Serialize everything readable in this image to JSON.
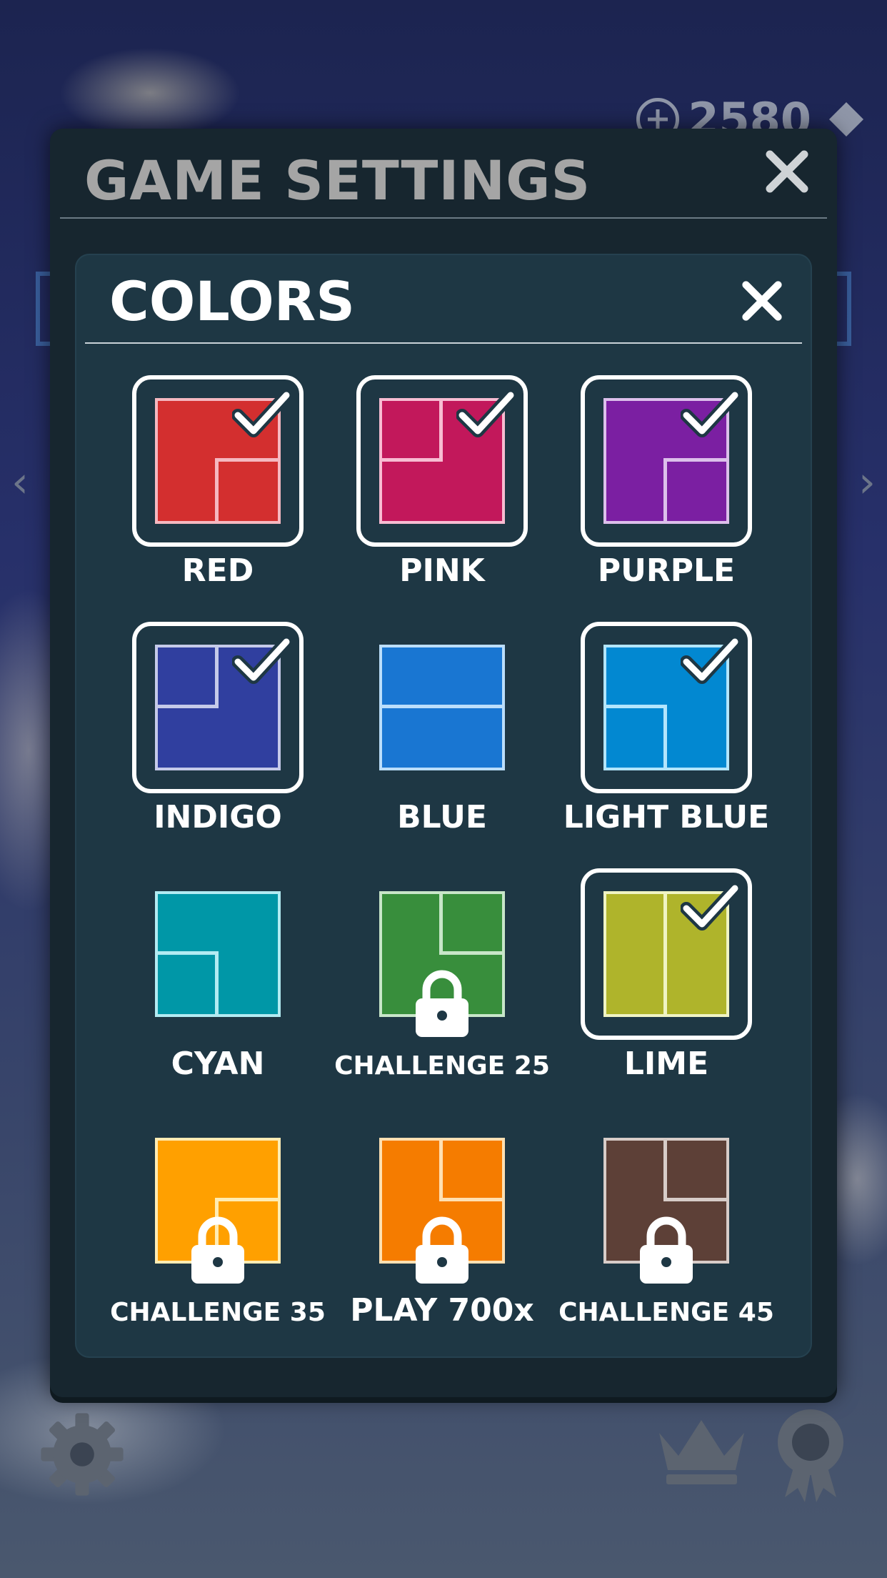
{
  "background": {
    "gems": "2580"
  },
  "settings": {
    "title": "GAME SETTINGS"
  },
  "colors_panel": {
    "title": "COLORS",
    "tiles": [
      {
        "label": "RED",
        "color": "#d32f2f",
        "line": "#f5b8c0",
        "selected": true,
        "locked": false
      },
      {
        "label": "PINK",
        "color": "#c2185b",
        "line": "#f7bcd2",
        "selected": true,
        "locked": false
      },
      {
        "label": "PURPLE",
        "color": "#7b1fa2",
        "line": "#dcbfeb",
        "selected": true,
        "locked": false
      },
      {
        "label": "INDIGO",
        "color": "#303f9f",
        "line": "#c5cae9",
        "selected": true,
        "locked": false
      },
      {
        "label": "BLUE",
        "color": "#1976d2",
        "line": "#bbdefb",
        "selected": false,
        "locked": false
      },
      {
        "label": "LIGHT BLUE",
        "color": "#0288d1",
        "line": "#b3e5fc",
        "selected": true,
        "locked": false
      },
      {
        "label": "CYAN",
        "color": "#0097a7",
        "line": "#b2ebf2",
        "selected": false,
        "locked": false
      },
      {
        "label": "CHALLENGE 25",
        "color": "#388e3c",
        "line": "#c8e6c9",
        "selected": false,
        "locked": true
      },
      {
        "label": "LIME",
        "color": "#afb42b",
        "line": "#f0f4c3",
        "selected": true,
        "locked": false
      },
      {
        "label": "CHALLENGE 35",
        "color": "#ffa000",
        "line": "#ffecb3",
        "selected": false,
        "locked": true
      },
      {
        "label": "PLAY 700x",
        "color": "#f57c00",
        "line": "#ffe0b2",
        "selected": false,
        "locked": true
      },
      {
        "label": "CHALLENGE 45",
        "color": "#5d4037",
        "line": "#d7ccc8",
        "selected": false,
        "locked": true
      }
    ]
  }
}
